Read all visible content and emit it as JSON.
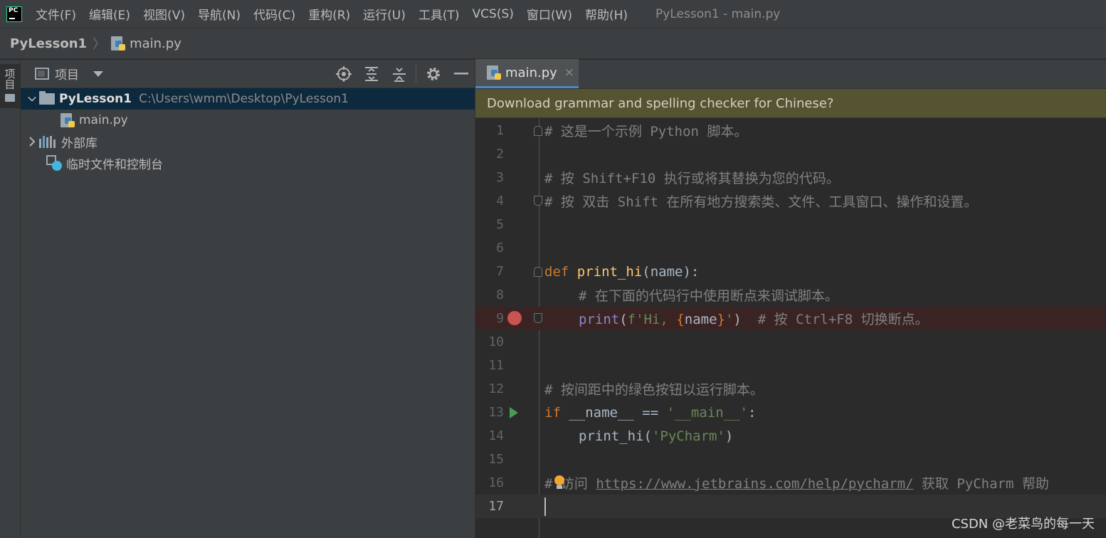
{
  "menubar": {
    "items": [
      "文件(F)",
      "编辑(E)",
      "视图(V)",
      "导航(N)",
      "代码(C)",
      "重构(R)",
      "运行(U)",
      "工具(T)",
      "VCS(S)",
      "窗口(W)",
      "帮助(H)"
    ],
    "window_title": "PyLesson1 - main.py",
    "logo_text": "PC"
  },
  "breadcrumbs": {
    "project": "PyLesson1",
    "file": "main.py"
  },
  "toolstrip": {
    "project_label": "项目"
  },
  "project_panel": {
    "title": "项目",
    "tree": {
      "root_name": "PyLesson1",
      "root_path": "C:\\Users\\wmm\\Desktop\\PyLesson1",
      "file": "main.py",
      "external_libs": "外部库",
      "scratches": "临时文件和控制台"
    }
  },
  "editor": {
    "tab": "main.py",
    "tab_close": "×",
    "banner": "Download grammar and spelling checker for Chinese?",
    "lines": {
      "l1": "# 这是一个示例 Python 脚本。",
      "l3": "# 按 Shift+F10 执行或将其替换为您的代码。",
      "l4": "# 按 双击 Shift 在所有地方搜索类、文件、工具窗口、操作和设置。",
      "l7_kw": "def",
      "l7_fn": "print_hi",
      "l7_rest": "(name):",
      "l8": "# 在下面的代码行中使用断点来调试脚本。",
      "l9_builtin": "print",
      "l9_p1": "(",
      "l9_str1": "f'Hi, ",
      "l9_b1": "{",
      "l9_var": "name",
      "l9_b2": "}",
      "l9_str2": "'",
      "l9_p2": ")",
      "l9_comment": "# 按 Ctrl+F8 切换断点。",
      "l12": "# 按间距中的绿色按钮以运行脚本。",
      "l13_kw": "if",
      "l13_mid": " __name__ == ",
      "l13_str": "'__main__'",
      "l13_end": ":",
      "l14_fn": "print_hi(",
      "l14_str": "'PyCharm'",
      "l14_end": ")",
      "l16_pre": "# 访问 ",
      "l16_link": "https://www.jetbrains.com/help/pycharm/",
      "l16_post": " 获取 PyCharm 帮助"
    },
    "line_numbers": [
      "1",
      "2",
      "3",
      "4",
      "5",
      "6",
      "7",
      "8",
      "9",
      "10",
      "11",
      "12",
      "13",
      "14",
      "15",
      "16",
      "17"
    ],
    "current_line": 17,
    "breakpoint_line": 9
  },
  "watermark": "CSDN @老菜鸟的每一天"
}
